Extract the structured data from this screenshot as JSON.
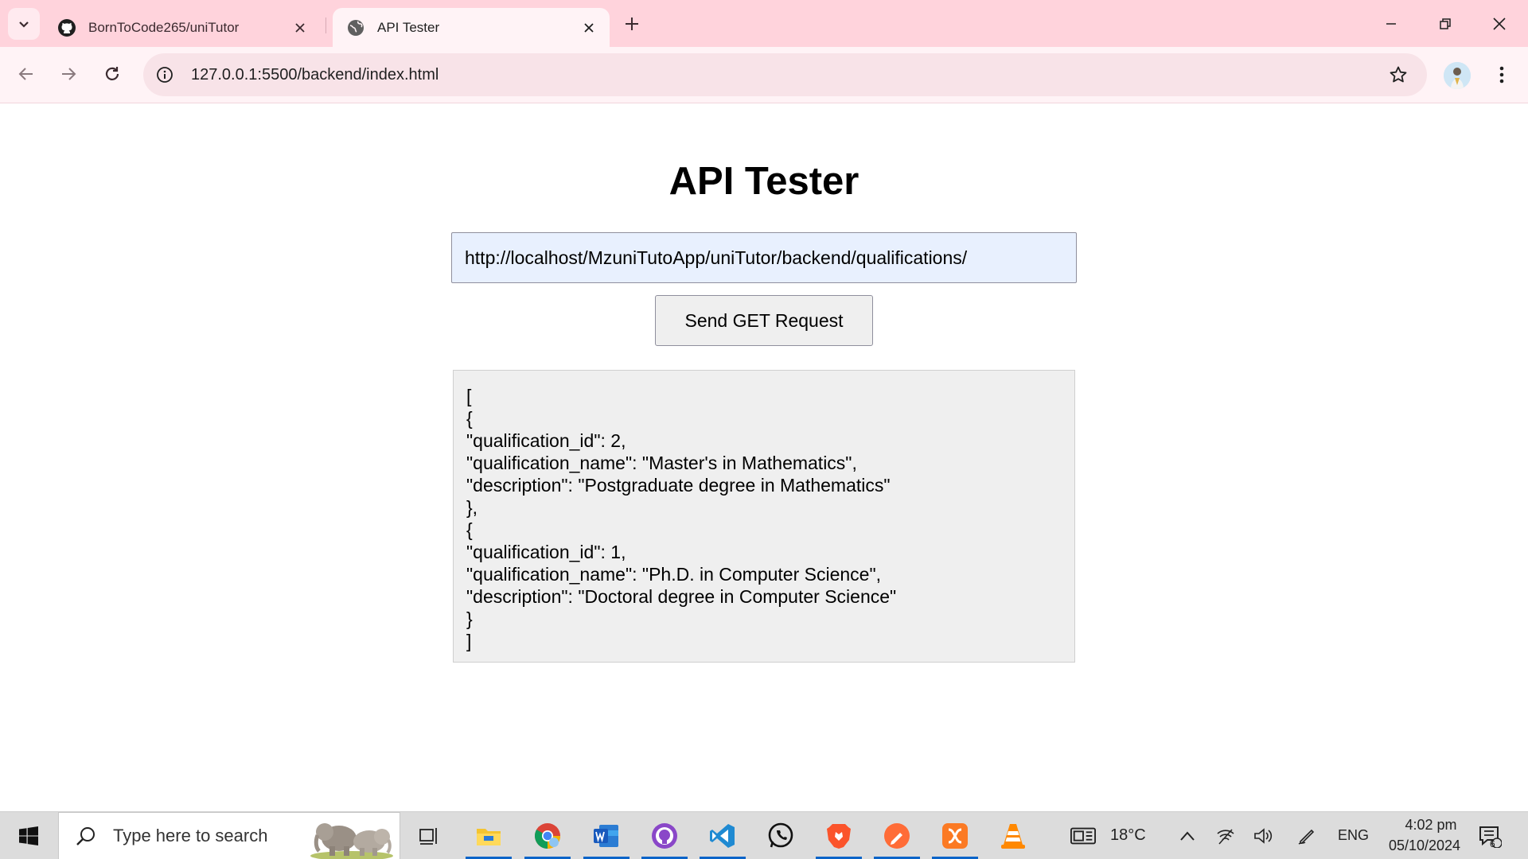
{
  "browser": {
    "tabs": [
      {
        "title": "BornToCode265/uniTutor",
        "favicon": "github-icon",
        "active": false
      },
      {
        "title": "API Tester",
        "favicon": "globe-icon",
        "active": true
      }
    ],
    "address_bar": {
      "url": "127.0.0.1:5500/backend/index.html"
    }
  },
  "page": {
    "title": "API Tester",
    "url_input": {
      "value": "http://localhost/MzuniTutoApp/uniTutor/backend/qualifications/"
    },
    "send_button_label": "Send GET Request",
    "response_lines": [
      "[",
      "{",
      "\"qualification_id\": 2,",
      "\"qualification_name\": \"Master's in Mathematics\",",
      "\"description\": \"Postgraduate degree in Mathematics\"",
      "},",
      "{",
      "\"qualification_id\": 1,",
      "\"qualification_name\": \"Ph.D. in Computer Science\",",
      "\"description\": \"Doctoral degree in Computer Science\"",
      "}",
      "]"
    ]
  },
  "taskbar": {
    "search_placeholder": "Type here to search",
    "pinned_apps": [
      "task-view",
      "file-explorer",
      "chrome",
      "word",
      "github-desktop",
      "vscode",
      "whatsapp",
      "brave",
      "postman",
      "xampp",
      "vlc"
    ],
    "weather": {
      "temperature": "18°C"
    },
    "language": "ENG",
    "time": "4:02 pm",
    "date": "05/10/2024",
    "notification_count": "6"
  },
  "colors": {
    "tabstrip": "#ffd3dc",
    "toolbar": "#fff3f6",
    "omnibox": "#f8e3e8",
    "input_autofill": "#e8f0fe",
    "response_bg": "#efefef",
    "taskbar": "#dcdcdc",
    "taskbar_active": "#0a64c8"
  }
}
